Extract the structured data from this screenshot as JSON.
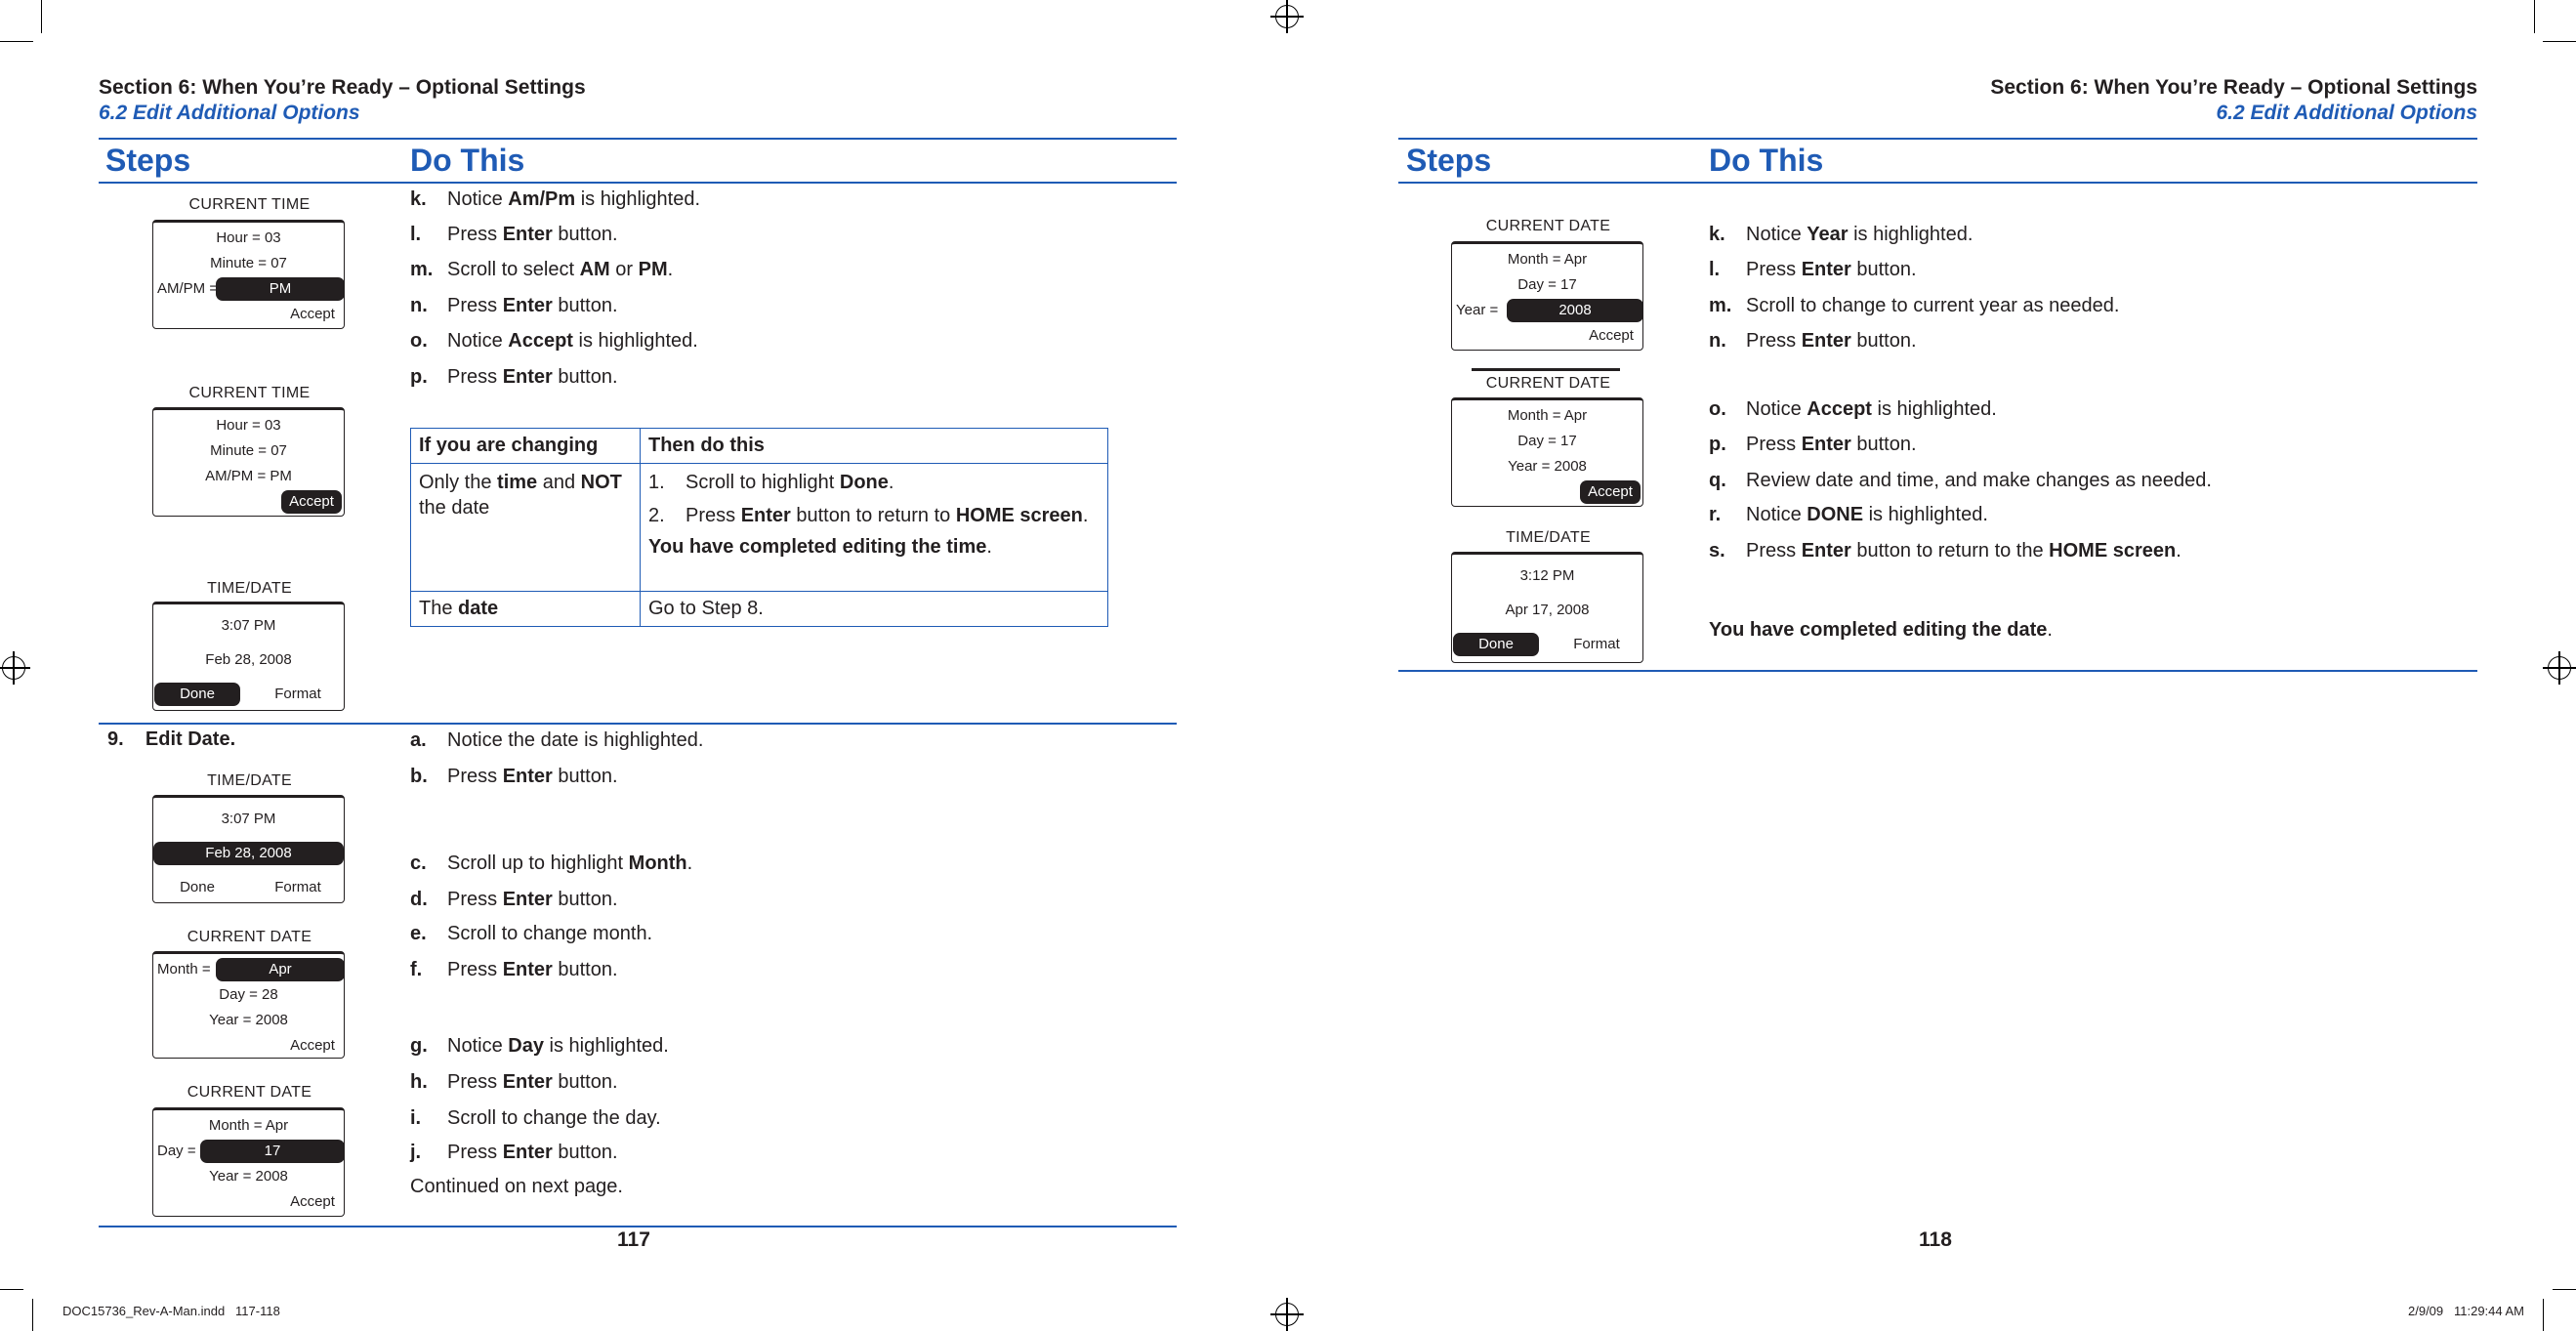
{
  "left_page": {
    "section_title": "Section 6: When You’re Ready – Optional Settings",
    "section_subtitle": "6.2 Edit Additional Options",
    "col_steps": "Steps",
    "col_do_this": "Do This",
    "step_9_label": "9.    Edit Date.",
    "items_top": [
      {
        "letter": "k.",
        "segs": [
          {
            "t": "Notice "
          },
          {
            "t": "Am/Pm",
            "b": true
          },
          {
            "t": " is highlighted."
          }
        ]
      },
      {
        "letter": "l.",
        "segs": [
          {
            "t": "Press "
          },
          {
            "t": "Enter",
            "b": true
          },
          {
            "t": " button."
          }
        ]
      },
      {
        "letter": "m.",
        "segs": [
          {
            "t": "Scroll to select "
          },
          {
            "t": "AM",
            "b": true
          },
          {
            "t": " or "
          },
          {
            "t": "PM",
            "b": true
          },
          {
            "t": "."
          }
        ]
      },
      {
        "letter": "n.",
        "segs": [
          {
            "t": "Press "
          },
          {
            "t": "Enter",
            "b": true
          },
          {
            "t": " button."
          }
        ]
      },
      {
        "letter": "o.",
        "segs": [
          {
            "t": "Notice "
          },
          {
            "t": "Accept",
            "b": true
          },
          {
            "t": " is highlighted."
          }
        ]
      },
      {
        "letter": "p.",
        "segs": [
          {
            "t": "Press "
          },
          {
            "t": "Enter",
            "b": true
          },
          {
            "t": " button."
          }
        ]
      }
    ],
    "table": {
      "header": [
        "If you are changing",
        "Then do this"
      ],
      "row1_left": [
        {
          "t": "Only the "
        },
        {
          "t": "time",
          "b": true
        },
        {
          "t": " and "
        },
        {
          "t": "NOT",
          "b": true
        },
        {
          "t": " the date"
        }
      ],
      "row1_steps": [
        {
          "n": "1.",
          "segs": [
            {
              "t": "Scroll to highlight "
            },
            {
              "t": "Done",
              "b": true
            },
            {
              "t": "."
            }
          ]
        },
        {
          "n": "2.",
          "segs": [
            {
              "t": "Press "
            },
            {
              "t": "Enter",
              "b": true
            },
            {
              "t": " button to return to "
            },
            {
              "t": "HOME screen",
              "b": true
            },
            {
              "t": "."
            }
          ]
        }
      ],
      "row1_note": [
        {
          "t": "You have completed editing the time",
          "b": true
        },
        {
          "t": "."
        }
      ],
      "row2_left": [
        {
          "t": "The "
        },
        {
          "t": "date",
          "b": true
        }
      ],
      "row2_right": [
        {
          "t": "Go to Step 8."
        }
      ]
    },
    "items_step9": [
      {
        "letter": "a.",
        "segs": [
          {
            "t": "Notice the date is highlighted."
          }
        ]
      },
      {
        "letter": "b.",
        "segs": [
          {
            "t": "Press "
          },
          {
            "t": "Enter",
            "b": true
          },
          {
            "t": " button."
          }
        ]
      },
      {
        "letter": "c.",
        "segs": [
          {
            "t": "Scroll up to highlight "
          },
          {
            "t": "Month",
            "b": true
          },
          {
            "t": "."
          }
        ]
      },
      {
        "letter": "d.",
        "segs": [
          {
            "t": "Press "
          },
          {
            "t": "Enter",
            "b": true
          },
          {
            "t": " button."
          }
        ]
      },
      {
        "letter": "e.",
        "segs": [
          {
            "t": "Scroll to change month."
          }
        ]
      },
      {
        "letter": "f.",
        "segs": [
          {
            "t": "Press "
          },
          {
            "t": "Enter",
            "b": true
          },
          {
            "t": " button."
          }
        ]
      },
      {
        "letter": "g.",
        "segs": [
          {
            "t": "Notice "
          },
          {
            "t": "Day",
            "b": true
          },
          {
            "t": " is highlighted."
          }
        ]
      },
      {
        "letter": "h.",
        "segs": [
          {
            "t": "Press "
          },
          {
            "t": "Enter",
            "b": true
          },
          {
            "t": " button."
          }
        ]
      },
      {
        "letter": "i.",
        "segs": [
          {
            "t": "Scroll to change the day."
          }
        ]
      },
      {
        "letter": "j.",
        "segs": [
          {
            "t": "Press "
          },
          {
            "t": "Enter",
            "b": true
          },
          {
            "t": " button."
          }
        ]
      }
    ],
    "continued": "Continued on next page.",
    "page_number": "117",
    "screens": [
      {
        "title": "CURRENT TIME",
        "kind": "fields",
        "rows": [
          {
            "text": "Hour = 03"
          },
          {
            "text": "Minute = 07"
          },
          {
            "prefix": "AM/PM =",
            "value": "PM",
            "hl": true
          },
          {
            "text": "Accept",
            "accept": true
          }
        ]
      },
      {
        "title": "CURRENT TIME",
        "kind": "fields",
        "rows": [
          {
            "text": "Hour = 03"
          },
          {
            "text": "Minute = 07"
          },
          {
            "text": "AM/PM = PM"
          },
          {
            "text": "Accept",
            "accept": true,
            "hl": true
          }
        ]
      },
      {
        "title": "TIME/DATE",
        "kind": "timedate",
        "time": "3:07 PM",
        "date": "Feb 28, 2008",
        "date_hl": false,
        "buttons": [
          "Done",
          "Format"
        ],
        "btn_hl": 0
      },
      {
        "title": "TIME/DATE",
        "kind": "timedate",
        "time": "3:07 PM",
        "date": "Feb 28, 2008",
        "date_hl": true,
        "buttons": [
          "Done",
          "Format"
        ],
        "btn_hl": -1
      },
      {
        "title": "CURRENT DATE",
        "kind": "fields",
        "rows": [
          {
            "prefix": "Month =",
            "value": "Apr",
            "hl": true
          },
          {
            "text": "Day = 28"
          },
          {
            "text": "Year = 2008"
          },
          {
            "text": "Accept",
            "accept": true
          }
        ]
      },
      {
        "title": "CURRENT DATE",
        "kind": "fields",
        "rows": [
          {
            "text": "Month = Apr"
          },
          {
            "prefix": "Day =",
            "value": "17",
            "hl": true
          },
          {
            "text": "Year = 2008"
          },
          {
            "text": "Accept",
            "accept": true
          }
        ]
      }
    ]
  },
  "right_page": {
    "section_title": "Section 6: When You’re Ready – Optional Settings",
    "section_subtitle": "6.2 Edit Additional Options",
    "col_steps": "Steps",
    "col_do_this": "Do This",
    "items": [
      {
        "letter": "k.",
        "segs": [
          {
            "t": "Notice "
          },
          {
            "t": "Year",
            "b": true
          },
          {
            "t": " is highlighted."
          }
        ]
      },
      {
        "letter": "l.",
        "segs": [
          {
            "t": "Press "
          },
          {
            "t": "Enter",
            "b": true
          },
          {
            "t": " button."
          }
        ]
      },
      {
        "letter": "m.",
        "segs": [
          {
            "t": "Scroll to change to current year as needed."
          }
        ]
      },
      {
        "letter": "n.",
        "segs": [
          {
            "t": "Press "
          },
          {
            "t": "Enter",
            "b": true
          },
          {
            "t": " button."
          }
        ]
      },
      {
        "letter": "o.",
        "segs": [
          {
            "t": "Notice "
          },
          {
            "t": "Accept",
            "b": true
          },
          {
            "t": " is highlighted."
          }
        ]
      },
      {
        "letter": "p.",
        "segs": [
          {
            "t": "Press "
          },
          {
            "t": "Enter",
            "b": true
          },
          {
            "t": " button."
          }
        ]
      },
      {
        "letter": "q.",
        "segs": [
          {
            "t": "Review date and time, and make changes as needed."
          }
        ]
      },
      {
        "letter": "r.",
        "segs": [
          {
            "t": "Notice "
          },
          {
            "t": "DONE",
            "b": true
          },
          {
            "t": " is highlighted."
          }
        ]
      },
      {
        "letter": "s.",
        "segs": [
          {
            "t": "Press "
          },
          {
            "t": "Enter",
            "b": true
          },
          {
            "t": " button to return to the "
          },
          {
            "t": "HOME screen",
            "b": true
          },
          {
            "t": "."
          }
        ]
      }
    ],
    "completed": [
      {
        "t": "You have completed editing the date",
        "b": true
      },
      {
        "t": "."
      }
    ],
    "page_number": "118",
    "screens": [
      {
        "title": "CURRENT DATE",
        "kind": "fields",
        "rows": [
          {
            "text": "Month = Apr"
          },
          {
            "text": "Day = 17"
          },
          {
            "prefix": "Year =",
            "value": "2008",
            "hl": true
          },
          {
            "text": "Accept",
            "accept": true
          }
        ]
      },
      {
        "title": "CURRENT DATE",
        "kind": "fields",
        "rows": [
          {
            "text": "Month = Apr"
          },
          {
            "text": "Day = 17"
          },
          {
            "text": "Year = 2008"
          },
          {
            "text": "Accept",
            "accept": true,
            "hl": true
          }
        ]
      },
      {
        "title": "TIME/DATE",
        "kind": "timedate",
        "time": "3:12 PM",
        "date": "Apr 17, 2008",
        "date_hl": false,
        "buttons": [
          "Done",
          "Format"
        ],
        "btn_hl": 0
      }
    ]
  },
  "slug": {
    "file": "DOC15736_Rev-A-Man.indd   117-118",
    "timestamp": "2/9/09   11:29:44 AM"
  },
  "colors": {
    "accent": "#1f5bb5",
    "text": "#231f20"
  }
}
